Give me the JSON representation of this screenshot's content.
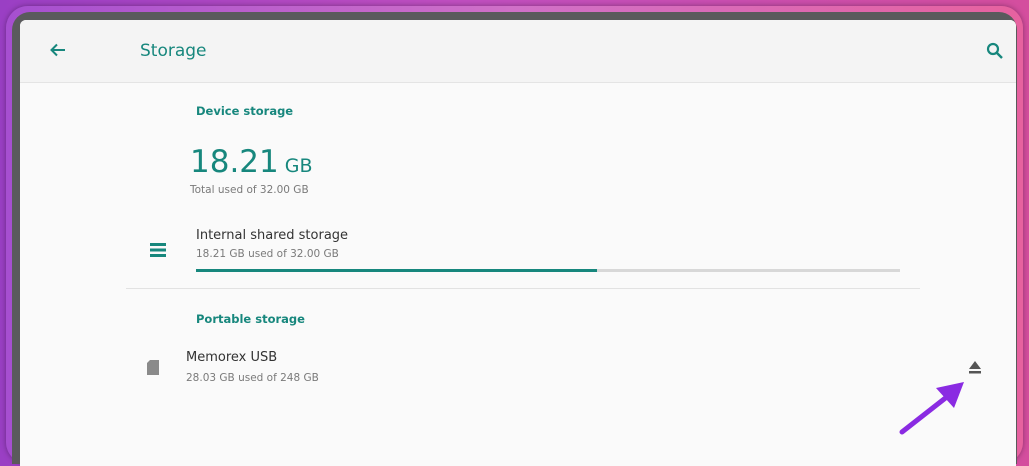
{
  "appbar": {
    "title": "Storage",
    "back_icon": "arrow-back-icon",
    "search_icon": "search-icon"
  },
  "device_storage": {
    "header": "Device storage",
    "total_value": "18.21",
    "total_unit": "GB",
    "total_caption": "Total used of 32.00 GB",
    "internal": {
      "icon": "storage-list-icon",
      "title": "Internal shared storage",
      "subtitle": "18.21 GB used of 32.00 GB",
      "used_fraction": 0.569
    }
  },
  "portable_storage": {
    "header": "Portable storage",
    "devices": [
      {
        "icon": "sd-card-icon",
        "name": "Memorex USB",
        "usage": "28.03 GB used of 248 GB",
        "action_icon": "eject-icon"
      }
    ]
  },
  "colors": {
    "accent": "#17877d",
    "annotation_arrow": "#8a2be2",
    "frame_gradient_start": "#a64fd0",
    "frame_gradient_end": "#e7629f"
  }
}
